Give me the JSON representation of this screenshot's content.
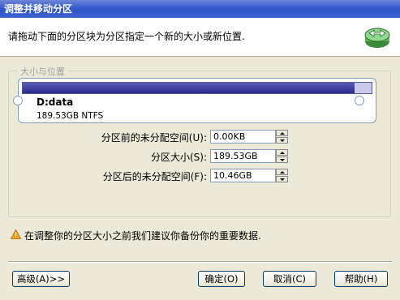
{
  "window": {
    "title": "调整并移动分区"
  },
  "header": {
    "instruction": "请拖动下面的分区块为分区指定一个新的大小或新位置."
  },
  "group": {
    "label": "大小与位置"
  },
  "partition": {
    "name": "D:data",
    "size_fs": "189.53GB NTFS",
    "fill_fraction": 0.95
  },
  "fields": {
    "before": {
      "label": "分区前的未分配空间(U):",
      "value": "0.00KB"
    },
    "size": {
      "label": "分区大小(S):",
      "value": "189.53GB"
    },
    "after": {
      "label": "分区后的未分配空间(F):",
      "value": "10.46GB"
    }
  },
  "warning": {
    "text": "在调整你的分区大小之前我们建议你备份你的重要数据."
  },
  "buttons": {
    "advanced": "高级(A)>>",
    "ok": "确定(O)",
    "cancel": "取消(C)",
    "help": "帮助(H)"
  },
  "colors": {
    "title_bar": "#2e54c8",
    "partition_bar": "#2c2c8c",
    "dialog_bg": "#ece9d8"
  },
  "icons": {
    "header": "partition-move-icon",
    "warning": "warning-triangle-icon"
  }
}
